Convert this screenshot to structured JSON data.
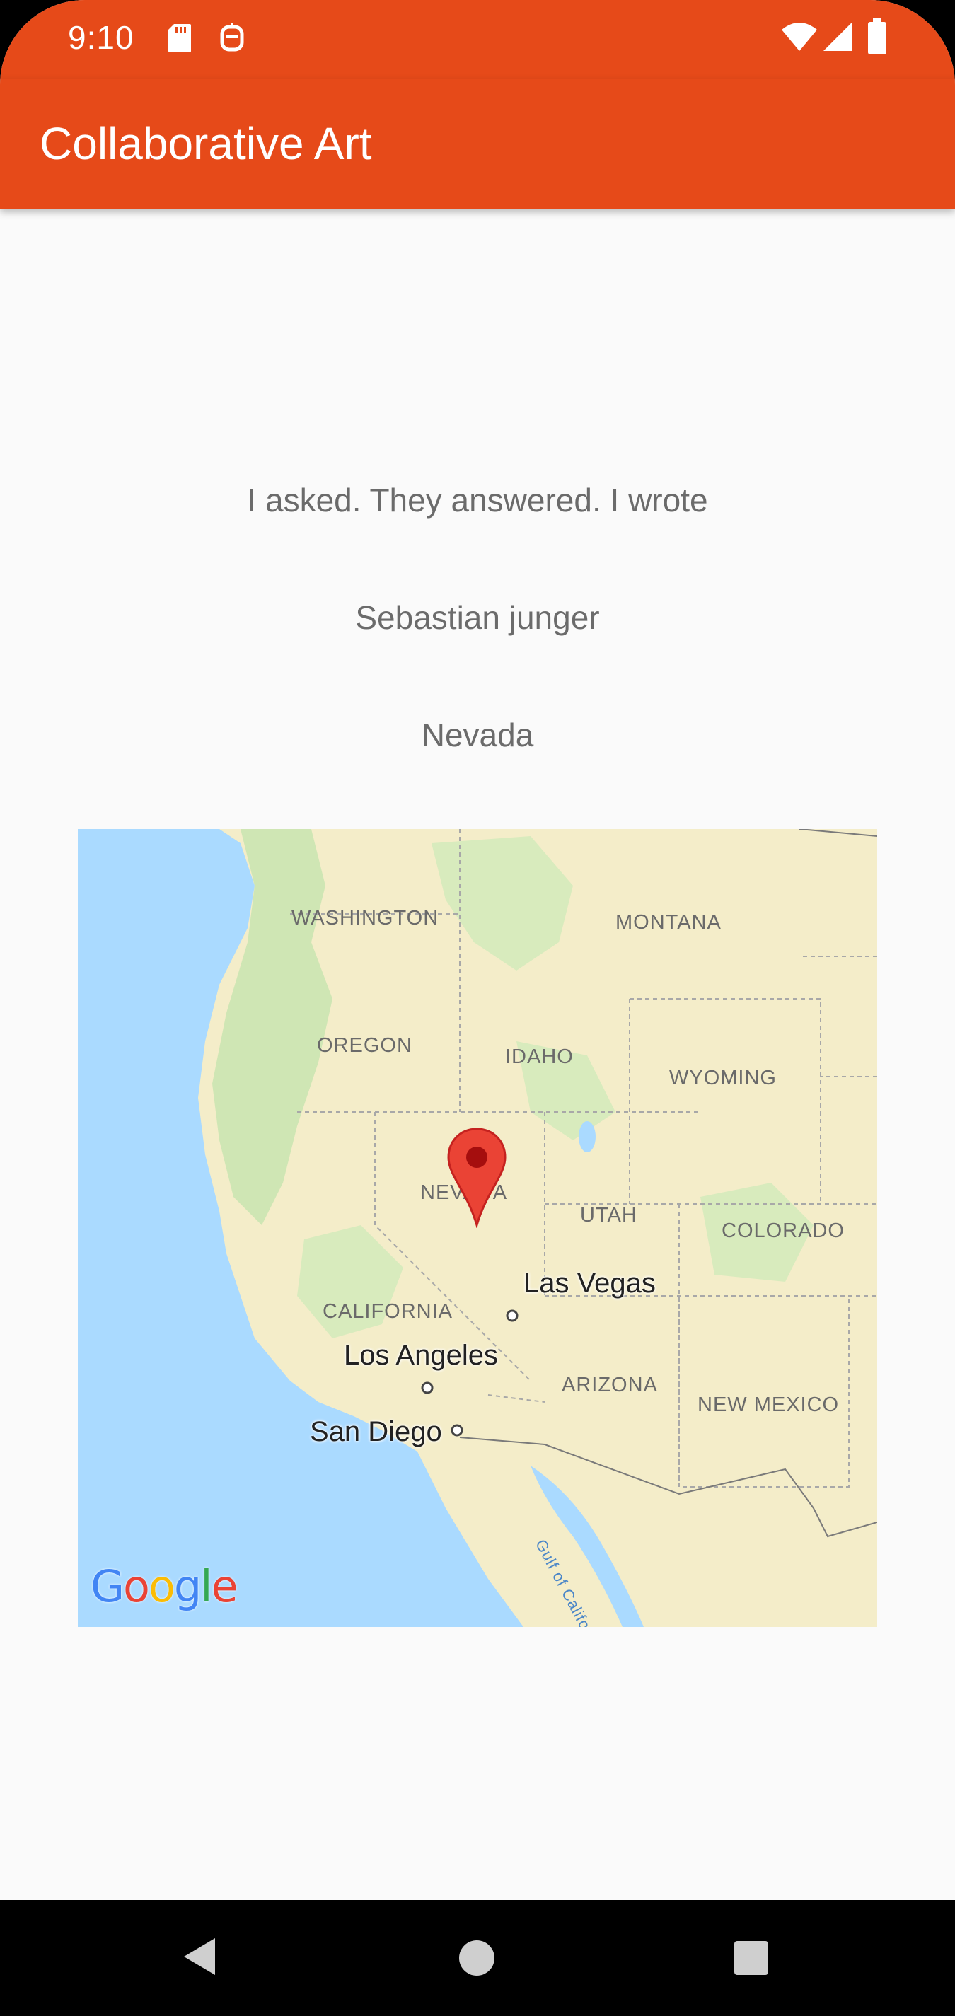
{
  "status_bar": {
    "time": "9:10",
    "icons": [
      "sd-card-icon",
      "rocket-icon",
      "wifi-icon",
      "signal-icon",
      "battery-icon"
    ]
  },
  "app_bar": {
    "title": "Collaborative Art"
  },
  "content": {
    "line1": "I asked. They answered. I wrote",
    "line2": "Sebastian junger",
    "line3": "Nevada"
  },
  "map": {
    "state_labels": {
      "washington": "WASHINGTON",
      "montana": "MONTANA",
      "oregon": "OREGON",
      "idaho": "IDAHO",
      "wyoming": "WYOMING",
      "nevada": "NEVADA",
      "utah": "UTAH",
      "colorado": "COLORADO",
      "california": "CALIFORNIA",
      "arizona": "ARIZONA",
      "new_mexico": "NEW MEXICO"
    },
    "city_labels": {
      "las_vegas": "Las Vegas",
      "los_angeles": "Los Angeles",
      "san_diego": "San Diego"
    },
    "water_label": "Gulf of California",
    "logo": {
      "g1": "G",
      "o1": "o",
      "o2": "o",
      "g2": "g",
      "l": "l",
      "e": "e"
    },
    "colors": {
      "water": "#aadaff",
      "land": "#f4edc9",
      "forest": "#cfe6b4",
      "pin": "#ea4335"
    }
  },
  "nav_bar": {
    "back": "back-icon",
    "home": "home-icon",
    "recents": "recents-icon"
  }
}
